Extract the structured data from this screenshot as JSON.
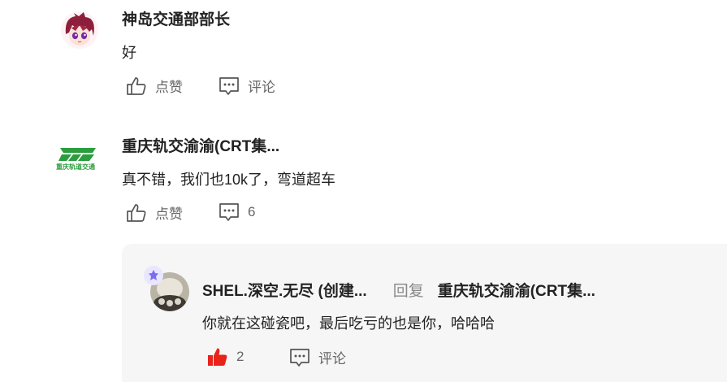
{
  "comments": [
    {
      "author": "神岛交通部部长",
      "text": "好",
      "like_label": "点赞",
      "comment_label": "评论"
    },
    {
      "author": "重庆轨交渝渝(CRT集...",
      "avatar_caption": "重庆轨道交通",
      "text": "真不错，我们也10k了，弯道超车",
      "like_label": "点赞",
      "reply_count": "6"
    }
  ],
  "reply": {
    "author": "SHEL.深空.无尽 (创建...",
    "reply_word": "回复",
    "reply_to": "重庆轨交渝渝(CRT集...",
    "text": "你就在这碰瓷吧，最后吃亏的也是你，哈哈哈",
    "like_count": "2",
    "comment_label": "评论"
  },
  "colors": {
    "accent_red": "#e8231a",
    "logo_green": "#2a9d3c",
    "badge_purple": "#7b6cf0"
  }
}
